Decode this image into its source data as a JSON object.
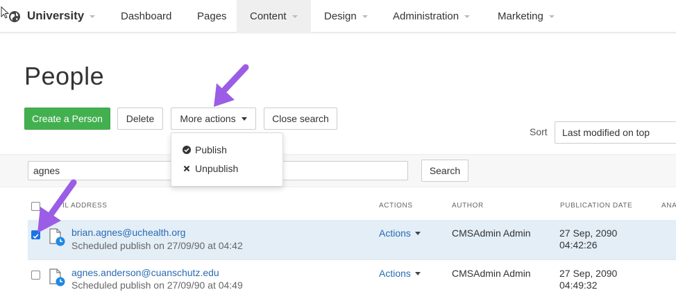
{
  "nav": {
    "brand": "University",
    "items": [
      {
        "label": "Dashboard",
        "dropdown": false
      },
      {
        "label": "Pages",
        "dropdown": false
      },
      {
        "label": "Content",
        "dropdown": true,
        "active": true
      },
      {
        "label": "Design",
        "dropdown": true
      },
      {
        "label": "Administration",
        "dropdown": true
      },
      {
        "label": "Marketing",
        "dropdown": true
      }
    ]
  },
  "page": {
    "title": "People"
  },
  "toolbar": {
    "create_label": "Create a Person",
    "delete_label": "Delete",
    "more_actions_label": "More actions",
    "close_search_label": "Close search"
  },
  "more_actions_menu": {
    "publish_label": "Publish",
    "unpublish_label": "Unpublish"
  },
  "sort": {
    "label": "Sort",
    "selected": "Last modified on top"
  },
  "search": {
    "value": "agnes",
    "button_label": "Search"
  },
  "table": {
    "columns": {
      "email": "IL ADDRESS",
      "actions": "ACTIONS",
      "author": "AUTHOR",
      "publication_date": "PUBLICATION DATE",
      "analytics": "ANA"
    },
    "rows": [
      {
        "email": "brian.agnes@uchealth.org",
        "status": "Scheduled publish on 27/09/90 at 04:42",
        "actions": "Actions",
        "author": "CMSAdmin Admin",
        "date": "27 Sep, 2090",
        "time": "04:42:26",
        "checked": true
      },
      {
        "email": "agnes.anderson@cuanschutz.edu",
        "status": "Scheduled publish on 27/09/90 at 04:49",
        "actions": "Actions",
        "author": "CMSAdmin Admin",
        "date": "27 Sep, 2090",
        "time": "04:49:32",
        "checked": false
      }
    ]
  },
  "colors": {
    "accent_green": "#43b050",
    "link_blue": "#2a6ab3",
    "annotation_purple": "#9b5de5",
    "selected_row": "#e3eef7"
  }
}
